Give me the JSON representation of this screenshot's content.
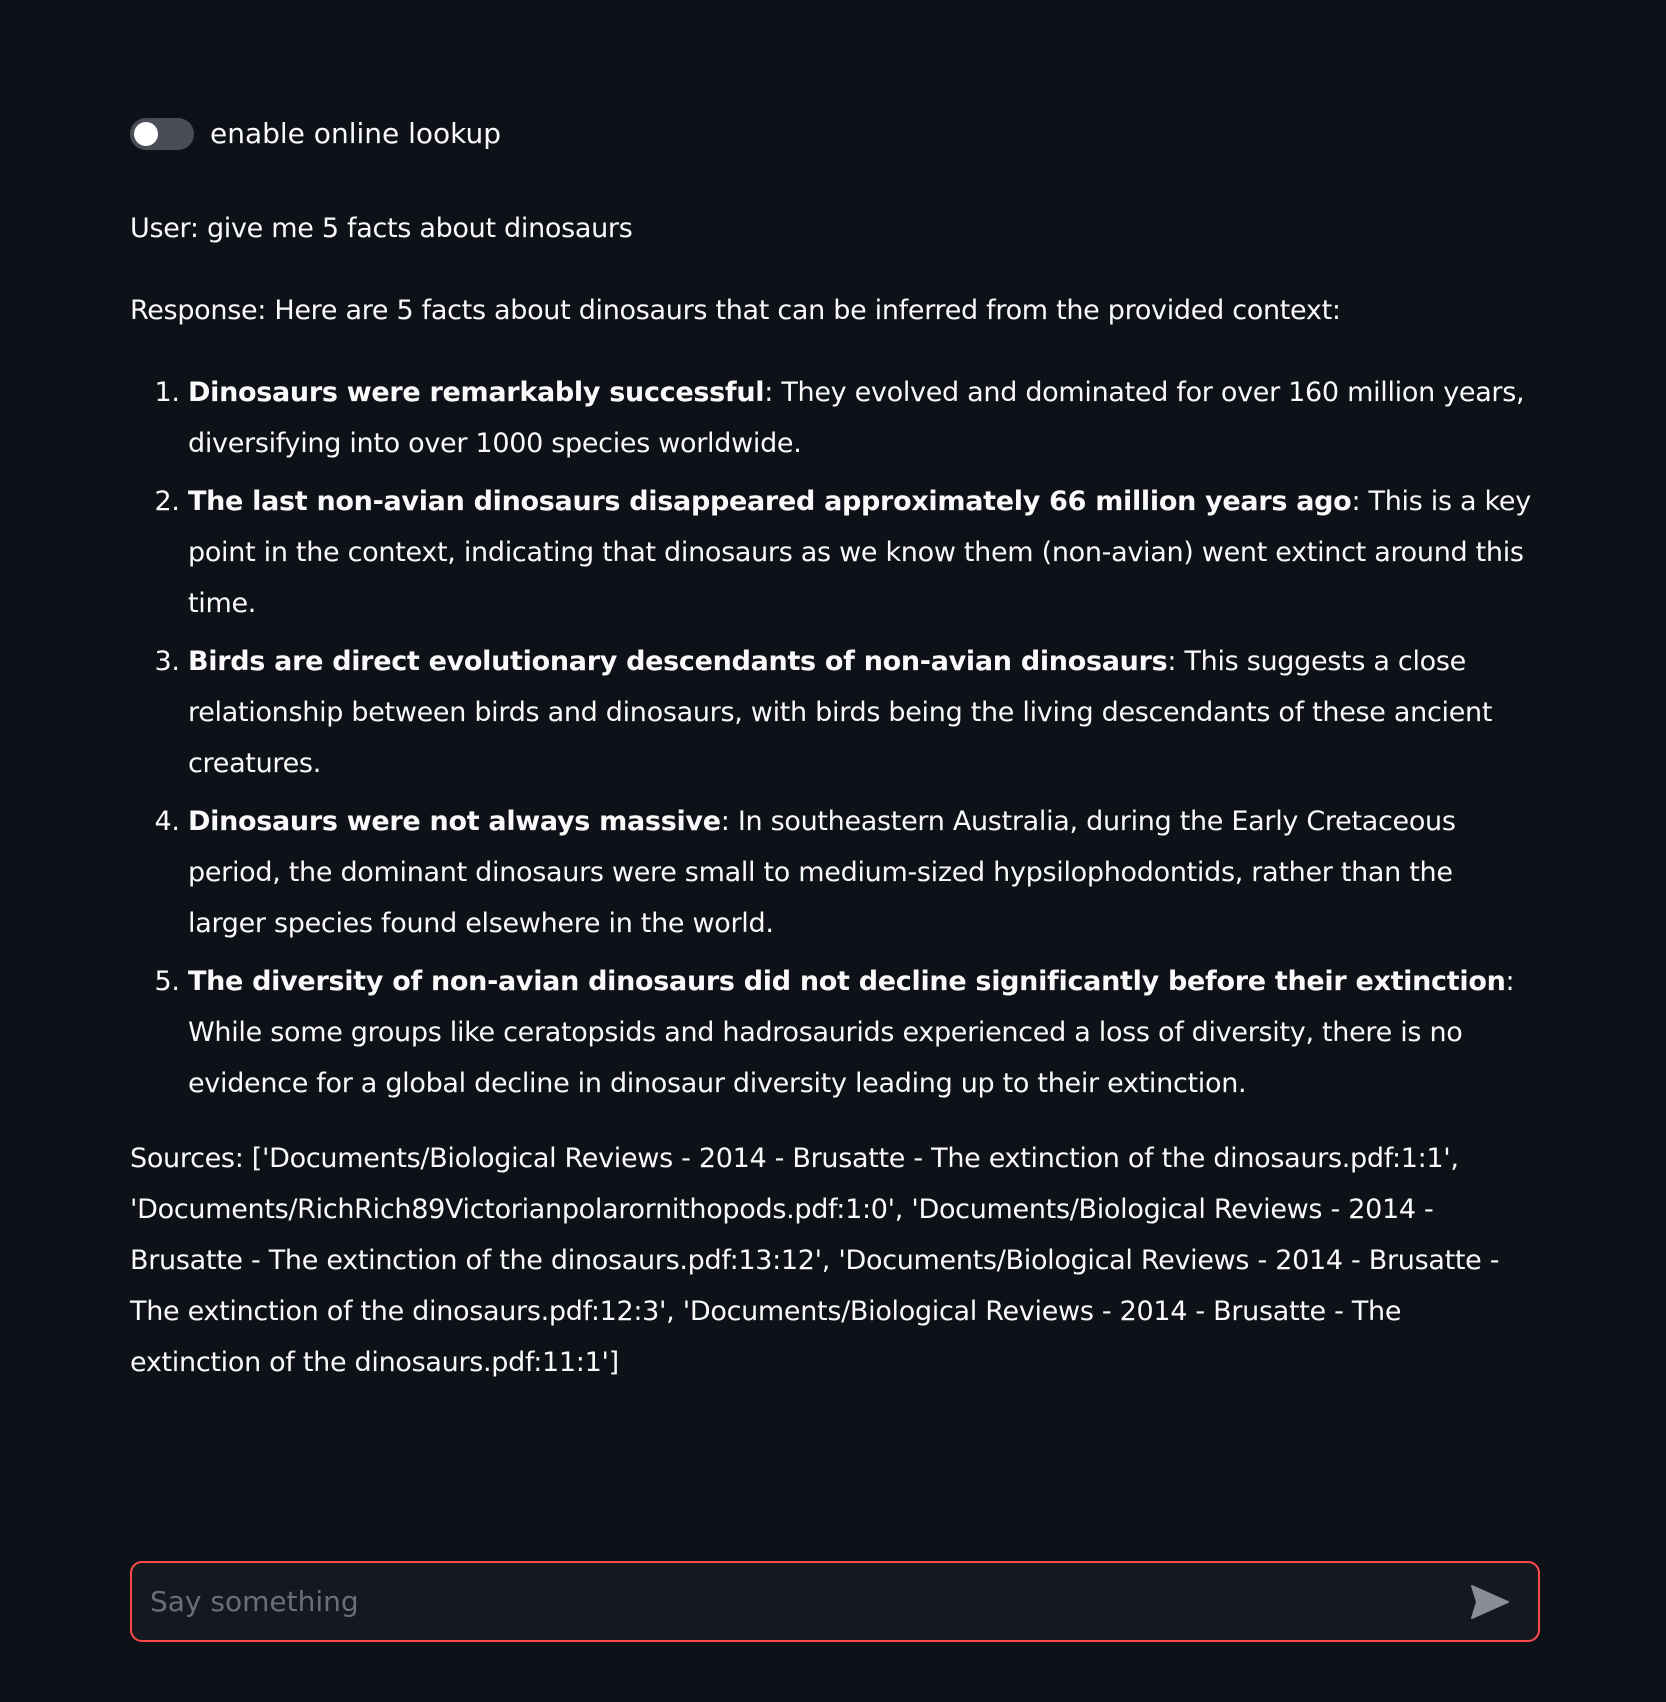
{
  "toggle": {
    "label": "enable online lookup",
    "checked": false
  },
  "chat": {
    "user_line": "User: give me 5 facts about dinosaurs",
    "response_intro": "Response: Here are 5 facts about dinosaurs that can be inferred from the provided context:",
    "facts": [
      {
        "bold": "Dinosaurs were remarkably successful",
        "text": ": They evolved and dominated for over 160 million years, diversifying into over 1000 species worldwide."
      },
      {
        "bold": "The last non-avian dinosaurs disappeared approximately 66 million years ago",
        "text": ": This is a key point in the context, indicating that dinosaurs as we know them (non-avian) went extinct around this time."
      },
      {
        "bold": "Birds are direct evolutionary descendants of non-avian dinosaurs",
        "text": ": This suggests a close relationship between birds and dinosaurs, with birds being the living descendants of these ancient creatures."
      },
      {
        "bold": "Dinosaurs were not always massive",
        "text": ": In southeastern Australia, during the Early Cretaceous period, the dominant dinosaurs were small to medium-sized hypsilophodontids, rather than the larger species found elsewhere in the world."
      },
      {
        "bold": "The diversity of non-avian dinosaurs did not decline significantly before their extinction",
        "text": ": While some groups like ceratopsids and hadrosaurids experienced a loss of diversity, there is no evidence for a global decline in dinosaur diversity leading up to their extinction."
      }
    ],
    "sources": "Sources: ['Documents/Biological Reviews - 2014 - Brusatte - The extinction of the dinosaurs.pdf:1:1', 'Documents/RichRich89Victorianpolarornithopods.pdf:1:0', 'Documents/Biological Reviews - 2014 - Brusatte - The extinction of the dinosaurs.pdf:13:12', 'Documents/Biological Reviews - 2014 - Brusatte - The extinction of the dinosaurs.pdf:12:3', 'Documents/Biological Reviews - 2014 - Brusatte - The extinction of the dinosaurs.pdf:11:1']"
  },
  "input": {
    "placeholder": "Say something",
    "value": ""
  },
  "colors": {
    "background": "#0e1117",
    "text": "#fafafa",
    "toggle_off": "#4a4d55",
    "input_border_focus": "#ff4b4b",
    "input_background": "#16181f",
    "send_icon": "#8b8d96"
  },
  "icons": {
    "send": "send-icon"
  }
}
